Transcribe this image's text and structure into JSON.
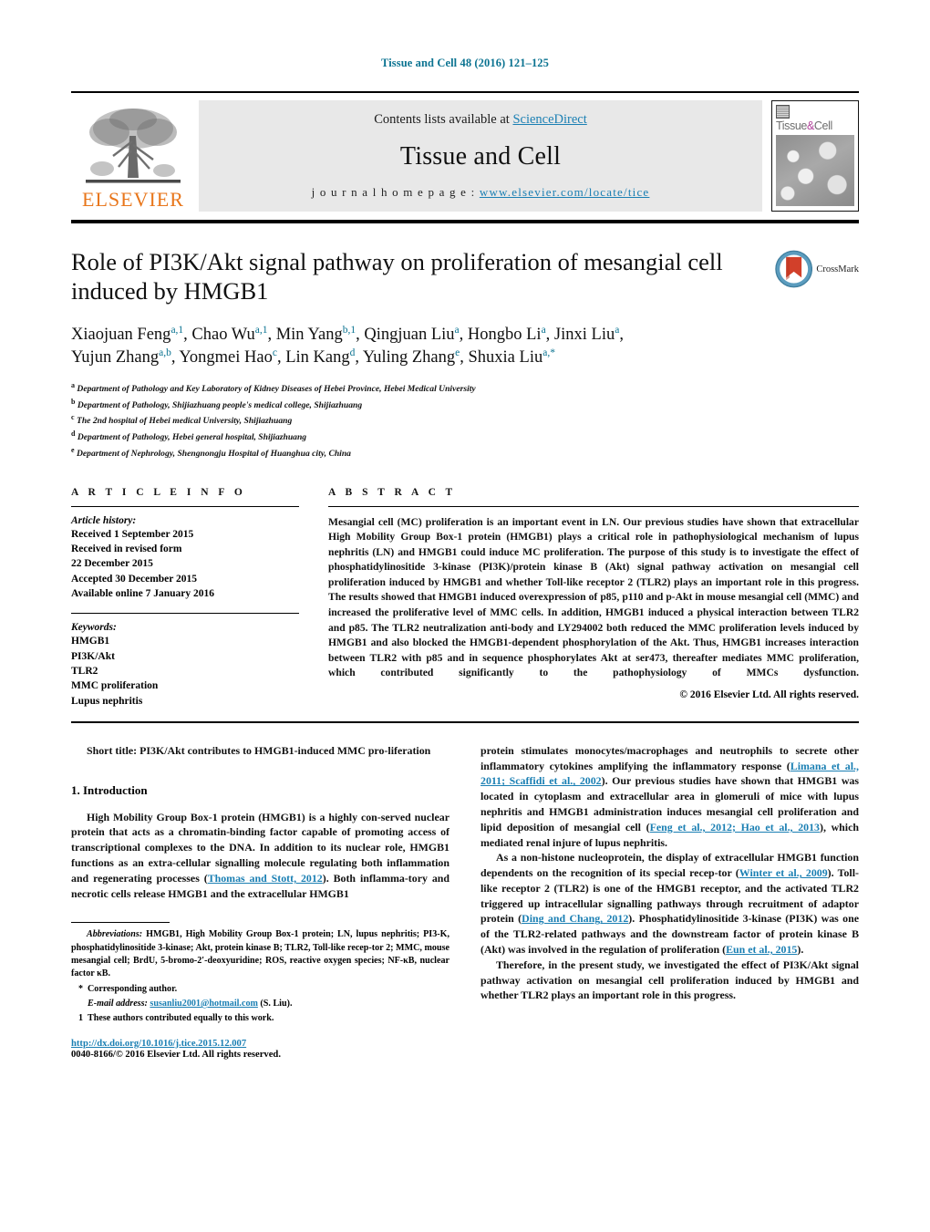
{
  "running_head": "Tissue and Cell 48 (2016) 121–125",
  "masthead": {
    "publisher_name": "ELSEVIER",
    "contents_prefix": "Contents lists available at ",
    "contents_link": "ScienceDirect",
    "journal_title": "Tissue and Cell",
    "homepage_label": "j o u r n a l   h o m e p a g e :  ",
    "homepage_url": "www.elsevier.com/locate/tice",
    "cover_name_left": "Tissue",
    "cover_name_amp": "&",
    "cover_name_right": "Cell"
  },
  "article": {
    "title": "Role of PI3K/Akt signal pathway on proliferation of mesangial cell induced by HMGB1",
    "crossmark_label": "CrossMark",
    "authors_line_1": "Xiaojuan Feng<sup>a,1</sup>, Chao Wu<sup>a,1</sup>, Min Yang<sup>b,1</sup>, Qingjuan Liu<sup>a</sup>, Hongbo Li<sup>a</sup>, Jinxi Liu<sup>a</sup>,",
    "authors_line_2": "Yujun Zhang<sup>a,b</sup>, Yongmei Hao<sup>c</sup>, Lin Kang<sup>d</sup>, Yuling Zhang<sup>e</sup>, Shuxia Liu<sup>a,*</sup>",
    "affiliations": [
      {
        "mark": "a",
        "text": "Department of Pathology and Key Laboratory of Kidney Diseases of Hebei Province, Hebei Medical University"
      },
      {
        "mark": "b",
        "text": "Department of Pathology, Shijiazhuang people's medical college, Shijiazhuang"
      },
      {
        "mark": "c",
        "text": "The 2nd hospital of Hebei medical University, Shijiazhuang"
      },
      {
        "mark": "d",
        "text": "Department of Pathology, Hebei general hospital, Shijiazhuang"
      },
      {
        "mark": "e",
        "text": "Department of Nephrology, Shengnongju Hospital of Huanghua city, China"
      }
    ]
  },
  "article_info": {
    "heading": "A R T I C L E   I N F O",
    "history_label": "Article history:",
    "history": [
      "Received 1 September 2015",
      "Received in revised form",
      "22 December 2015",
      "Accepted 30 December 2015",
      "Available online 7 January 2016"
    ],
    "keywords_label": "Keywords:",
    "keywords": [
      "HMGB1",
      "PI3K/Akt",
      "TLR2",
      "MMC proliferation",
      "Lupus nephritis"
    ]
  },
  "abstract": {
    "heading": "A B S T R A C T",
    "text": "Mesangial cell (MC) proliferation is an important event in LN. Our previous studies have shown that extracellular High Mobility Group Box-1 protein (HMGB1) plays a critical role in pathophysiological mechanism of lupus nephritis (LN) and HMGB1 could induce MC proliferation. The purpose of this study is to investigate the effect of phosphatidylinositide 3-kinase (PI3K)/protein kinase B (Akt) signal pathway activation on mesangial cell proliferation induced by HMGB1 and whether Toll-like receptor 2 (TLR2) plays an important role in this progress. The results showed that HMGB1 induced overexpression of p85, p110 and p-Akt in mouse mesangial cell (MMC) and increased the proliferative level of MMC cells. In addition, HMGB1 induced a physical interaction between TLR2 and p85. The TLR2 neutralization anti-body and LY294002 both reduced the MMC proliferation levels induced by HMGB1 and also blocked the HMGB1-dependent phosphorylation of the Akt. Thus, HMGB1 increases interaction between TLR2 with p85 and in sequence phosphorylates Akt at ser473, thereafter mediates MMC proliferation, which contributed significantly to the pathophysiology of MMCs dysfunction.",
    "copyright": "© 2016 Elsevier Ltd. All rights reserved."
  },
  "body": {
    "short_title_label": "Short title:",
    "short_title_text": " PI3K/Akt contributes to HMGB1-induced MMC pro-liferation",
    "intro_heading": "1.  Introduction",
    "left_para_1_a": "High Mobility Group Box-1 protein (HMGB1) is a highly con-served nuclear protein that acts as a chromatin-binding factor capable of promoting access of transcriptional complexes to the DNA. In addition to its nuclear role, HMGB1 functions as an extra-cellular signalling molecule regulating both inflammation and regenerating processes (",
    "left_para_1_cite": "Thomas and Stott, 2012",
    "left_para_1_b": "). Both inflamma-tory and necrotic cells release HMGB1 and the extracellular HMGB1",
    "right_para_1_a": "protein stimulates monocytes/macrophages and neutrophils to secrete other inflammatory cytokines amplifying the inflammatory response (",
    "right_para_1_cite1": "Limana et al., 2011; Scaffidi et al., 2002",
    "right_para_1_b": "). Our previous studies have shown that HMGB1 was located in cytoplasm and extracellular area in glomeruli of mice with lupus nephritis and HMGB1 administration induces mesangial cell proliferation and lipid deposition of mesangial cell (",
    "right_para_1_cite2": "Feng et al., 2012; Hao et al., 2013",
    "right_para_1_c": "), which mediated renal injure of lupus nephritis.",
    "right_para_2_a": "As a non-histone nucleoprotein, the display of extracellular HMGB1 function dependents on the recognition of its special recep-tor (",
    "right_para_2_cite1": "Winter et al., 2009",
    "right_para_2_b": "). Toll-like receptor 2 (TLR2) is one of the HMGB1 receptor, and the activated TLR2 triggered up intracellular signalling pathways through recruitment of adaptor protein (",
    "right_para_2_cite2": "Ding and Chang, 2012",
    "right_para_2_c": "). Phosphatidylinositide 3-kinase (PI3K) was one of the TLR2-related pathways and the downstream factor of protein kinase B (Akt) was involved in the regulation of proliferation (",
    "right_para_2_cite3": "Eun et al., 2015",
    "right_para_2_d": ").",
    "right_para_3": "Therefore, in the present study, we investigated the effect of PI3K/Akt signal pathway activation on mesangial cell proliferation induced by HMGB1 and whether TLR2 plays an important role in this progress."
  },
  "footnotes": {
    "abbrev_label": "Abbreviations:",
    "abbrev_text": " HMGB1, High Mobility Group Box-1 protein; LN, lupus nephritis; PI3-K, phosphatidylinositide 3-kinase; Akt, protein kinase B; TLR2, Toll-like recep-tor 2; MMC, mouse mesangial cell; BrdU, 5-bromo-2′-deoxyuridine; ROS, reactive oxygen species; NF-κB, nuclear factor κB.",
    "corresponding_mark": "*",
    "corresponding_text": "Corresponding author.",
    "email_label": "E-mail address:",
    "email": "susanliu2001@hotmail.com",
    "email_suffix": " (S. Liu).",
    "equal_mark": "1",
    "equal_text": "These authors contributed equally to this work.",
    "doi": "http://dx.doi.org/10.1016/j.tice.2015.12.007",
    "issn": "0040-8166/© 2016 Elsevier Ltd. All rights reserved."
  },
  "colors": {
    "link": "#1a7fb3",
    "runhead": "#0b7391",
    "elsevier_orange": "#E8761B",
    "crossmark_blue": "#4a8fb5",
    "crossmark_red": "#d2402a"
  }
}
